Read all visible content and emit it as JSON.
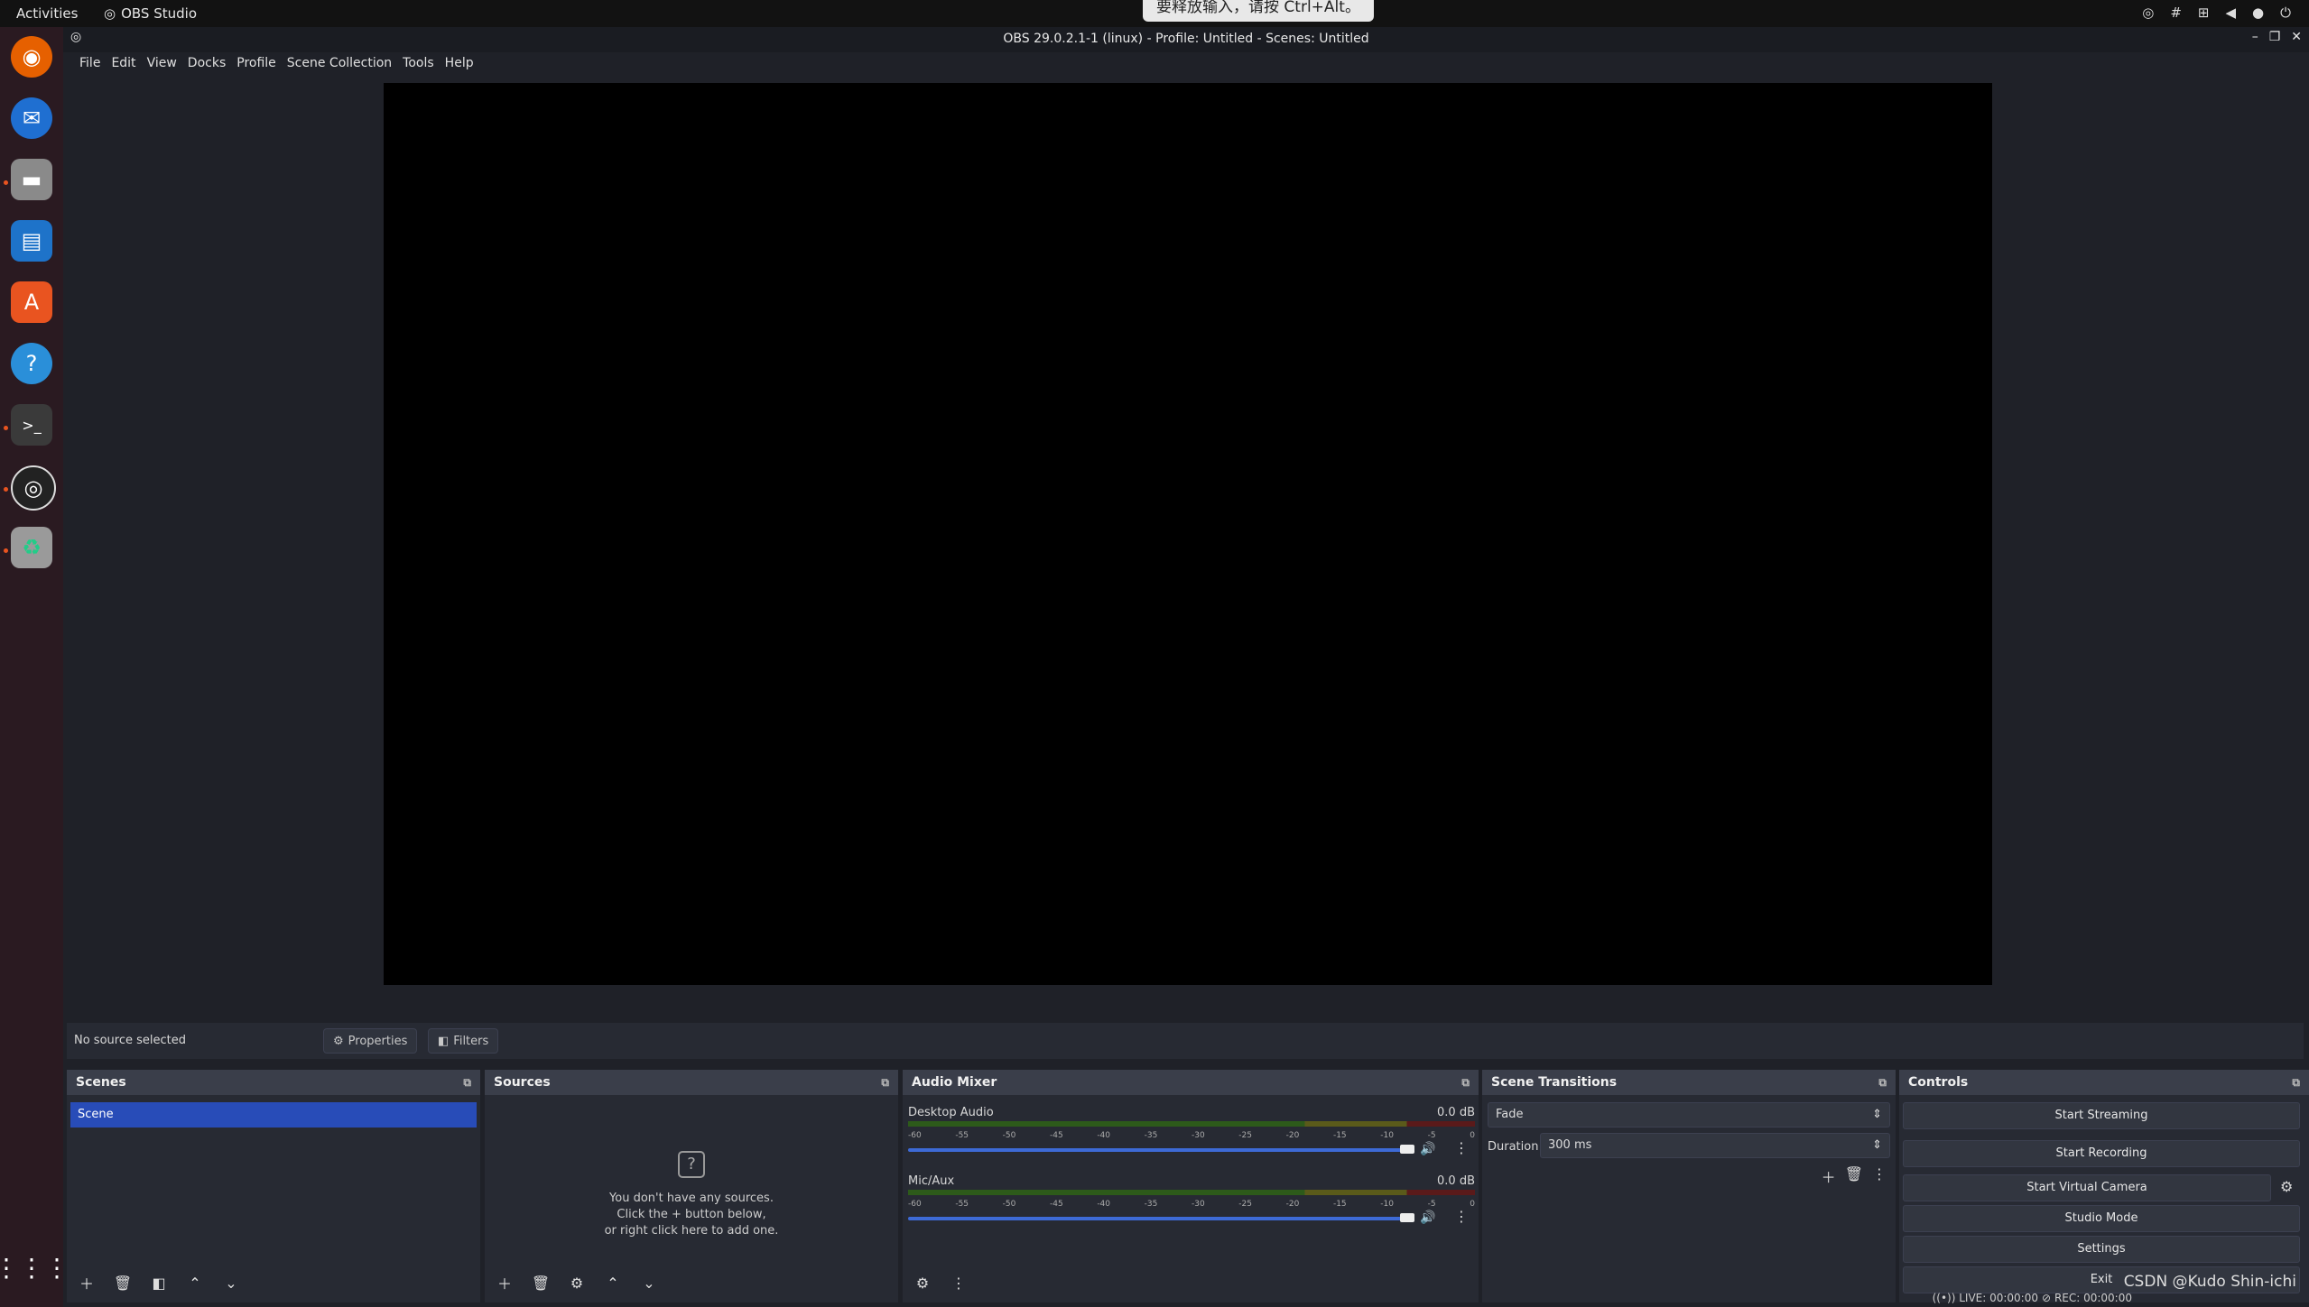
{
  "topbar": {
    "activities": "Activities",
    "app": "OBS Studio"
  },
  "toast": "要释放输入，请按 Ctrl+Alt。",
  "window": {
    "title": "OBS 29.0.2.1-1 (linux) - Profile: Untitled - Scenes: Untitled"
  },
  "menu": [
    "File",
    "Edit",
    "View",
    "Docks",
    "Profile",
    "Scene Collection",
    "Tools",
    "Help"
  ],
  "source_bar": {
    "no_selection": "No source selected",
    "properties": "Properties",
    "filters": "Filters"
  },
  "scenes": {
    "title": "Scenes",
    "items": [
      "Scene"
    ]
  },
  "sources": {
    "title": "Sources",
    "empty_line1": "You don't have any sources.",
    "empty_line2": "Click the + button below,",
    "empty_line3": "or right click here to add one."
  },
  "mixer": {
    "title": "Audio Mixer",
    "channels": [
      {
        "name": "Desktop Audio",
        "db": "0.0 dB",
        "volume": 1.0
      },
      {
        "name": "Mic/Aux",
        "db": "0.0 dB",
        "volume": 1.0
      }
    ],
    "ticks": [
      "-60",
      "-55",
      "-50",
      "-45",
      "-40",
      "-35",
      "-30",
      "-25",
      "-20",
      "-15",
      "-10",
      "-5",
      "0"
    ]
  },
  "transitions": {
    "title": "Scene Transitions",
    "selected": "Fade",
    "duration_label": "Duration",
    "duration_value": "300 ms"
  },
  "controls": {
    "title": "Controls",
    "start_streaming": "Start Streaming",
    "start_recording": "Start Recording",
    "start_virtual_camera": "Start Virtual Camera",
    "studio_mode": "Studio Mode",
    "settings": "Settings",
    "exit": "Exit"
  },
  "status": {
    "live": "LIVE: 00:00:00",
    "rec": "REC: 00:00:00"
  },
  "watermark": "CSDN @Kudo Shin-ichi",
  "colors": {
    "accent": "#284cb8",
    "preview": "#000000",
    "panel": "#272a33"
  }
}
